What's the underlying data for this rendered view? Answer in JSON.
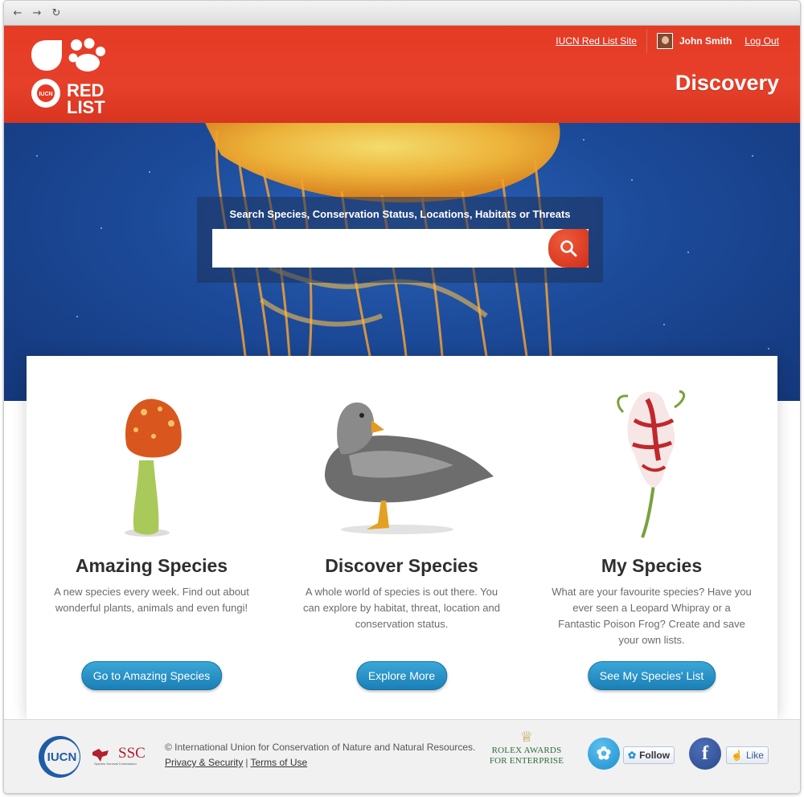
{
  "browser": {
    "back_icon": "arrow-left-icon",
    "forward_icon": "arrow-right-icon",
    "reload_icon": "reload-icon"
  },
  "header": {
    "logo_text_top": "RED",
    "logo_text_bottom": "LIST",
    "logo_badge": "IUCN",
    "site_link": "IUCN Red List Site",
    "user_name": "John Smith",
    "logout": "Log Out",
    "page_title": "Discovery",
    "accent_color": "#e53b25"
  },
  "search": {
    "label": "Search Species, Conservation Status, Locations, Habitats or Threats",
    "value": "",
    "placeholder": "",
    "button_icon": "magnifier-icon"
  },
  "features": [
    {
      "title": "Amazing Species",
      "description": "A new species every week. Find out about wonderful plants, animals and even fungi!",
      "button": "Go to Amazing Species",
      "image": "mushroom"
    },
    {
      "title": "Discover Species",
      "description": "A whole world of species is out there. You can explore by habitat, threat, location and conservation status.",
      "button": "Explore More",
      "image": "duck"
    },
    {
      "title": "My Species",
      "description": "What are your favourite species? Have you ever seen a Leopard Whipray or a Fantastic Poison Frog? Create and save your own lists.",
      "button": "See My Species' List",
      "image": "flower"
    }
  ],
  "footer": {
    "iucn_logo": "IUCN",
    "ssc_logo": "SSC",
    "ssc_sub": "Species Survival Commission",
    "copyright": "© International Union for Conservation of Nature and Natural Resources.",
    "privacy": "Privacy & Security",
    "terms": "Terms of Use",
    "rolex_line1": "Rolex Awards",
    "rolex_line2": "for Enterprise",
    "twitter_follow": "Follow",
    "facebook_like": "Like"
  }
}
